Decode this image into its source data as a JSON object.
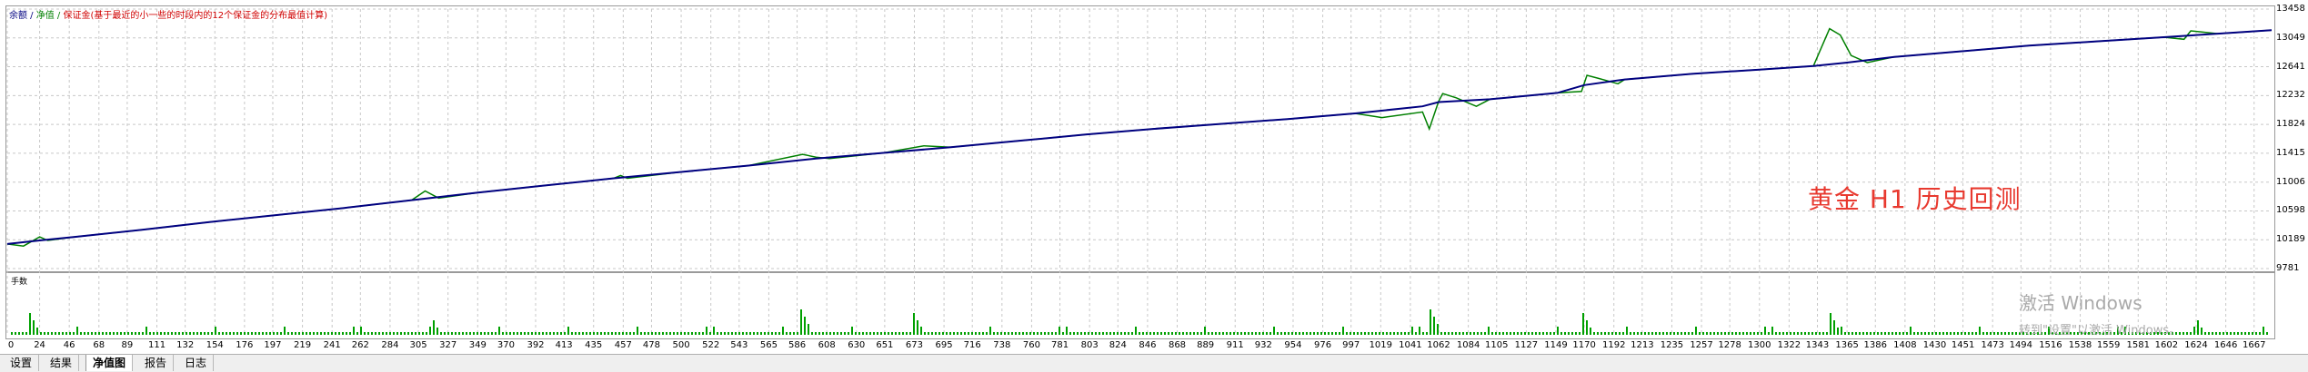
{
  "legend": {
    "balance": "余额",
    "sep1": " / ",
    "equity": "净值",
    "sep2": " / ",
    "margin_note": "保证金(基于最近的小一些的时段内的12个保证金的分布最值计算)"
  },
  "overlay_title": "黄金 H1 历史回测",
  "volume_label": "手数",
  "y_ticks": [
    "13458",
    "13049",
    "12641",
    "12232",
    "11824",
    "11415",
    "11006",
    "10598",
    "10189",
    "9781"
  ],
  "x_ticks": [
    "0",
    "24",
    "46",
    "68",
    "89",
    "111",
    "132",
    "154",
    "176",
    "197",
    "219",
    "241",
    "262",
    "284",
    "305",
    "327",
    "349",
    "370",
    "392",
    "413",
    "435",
    "457",
    "478",
    "500",
    "522",
    "543",
    "565",
    "586",
    "608",
    "630",
    "651",
    "673",
    "695",
    "716",
    "738",
    "760",
    "781",
    "803",
    "824",
    "846",
    "868",
    "889",
    "911",
    "932",
    "954",
    "976",
    "997",
    "1019",
    "1041",
    "1062",
    "1084",
    "1105",
    "1127",
    "1149",
    "1170",
    "1192",
    "1213",
    "1235",
    "1257",
    "1278",
    "1300",
    "1322",
    "1343",
    "1365",
    "1386",
    "1408",
    "1430",
    "1451",
    "1473",
    "1494",
    "1516",
    "1538",
    "1559",
    "1581",
    "1602",
    "1624",
    "1646",
    "1667"
  ],
  "tabs": [
    "设置",
    "结果",
    "净值图",
    "报告",
    "日志"
  ],
  "active_tab": "净值图",
  "windows_activate": {
    "line1": "激活 Windows",
    "line2": "转到\"设置\"以激活 Windows。"
  },
  "colors": {
    "balance": "#000080",
    "equity": "#008000",
    "volume": "#00a000",
    "title": "#e8392f",
    "grid": "#c8c8c8"
  },
  "chart_data": {
    "type": "line",
    "title": "",
    "xlabel": "",
    "ylabel": "",
    "ylim": [
      9781,
      13458
    ],
    "xlim": [
      0,
      1680
    ],
    "grid": true,
    "series": [
      {
        "name": "余额",
        "x": [
          0,
          24,
          50,
          100,
          150,
          200,
          250,
          300,
          350,
          400,
          450,
          500,
          550,
          600,
          650,
          700,
          750,
          800,
          850,
          900,
          950,
          1000,
          1050,
          1062,
          1100,
          1150,
          1170,
          1200,
          1250,
          1300,
          1340,
          1365,
          1400,
          1450,
          1500,
          1550,
          1600,
          1640,
          1680
        ],
        "values": [
          10130,
          10180,
          10230,
          10330,
          10440,
          10540,
          10640,
          10750,
          10860,
          10960,
          11060,
          11150,
          11240,
          11340,
          11420,
          11500,
          11590,
          11680,
          11760,
          11830,
          11900,
          11980,
          12080,
          12140,
          12180,
          12270,
          12380,
          12460,
          12540,
          12600,
          12650,
          12700,
          12780,
          12860,
          12940,
          13000,
          13060,
          13110,
          13160
        ]
      },
      {
        "name": "净值",
        "x": [
          0,
          12,
          24,
          30,
          50,
          100,
          150,
          200,
          250,
          300,
          310,
          320,
          350,
          400,
          450,
          455,
          460,
          500,
          550,
          590,
          600,
          610,
          650,
          680,
          700,
          750,
          800,
          850,
          900,
          950,
          1000,
          1020,
          1050,
          1055,
          1062,
          1065,
          1075,
          1090,
          1100,
          1150,
          1168,
          1172,
          1180,
          1195,
          1200,
          1250,
          1300,
          1340,
          1352,
          1360,
          1368,
          1380,
          1400,
          1450,
          1500,
          1550,
          1600,
          1615,
          1620,
          1640,
          1650,
          1680
        ],
        "values": [
          10130,
          10100,
          10230,
          10180,
          10230,
          10330,
          10440,
          10540,
          10640,
          10750,
          10880,
          10780,
          10860,
          10960,
          11060,
          11100,
          11060,
          11150,
          11240,
          11400,
          11360,
          11340,
          11420,
          11520,
          11500,
          11590,
          11680,
          11760,
          11830,
          11900,
          11980,
          11920,
          12000,
          11760,
          12150,
          12260,
          12200,
          12080,
          12180,
          12270,
          12290,
          12520,
          12480,
          12400,
          12460,
          12540,
          12600,
          12650,
          13180,
          13090,
          12800,
          12700,
          12780,
          12860,
          12940,
          13000,
          13060,
          13030,
          13150,
          13110,
          13120,
          13160
        ]
      }
    ]
  }
}
